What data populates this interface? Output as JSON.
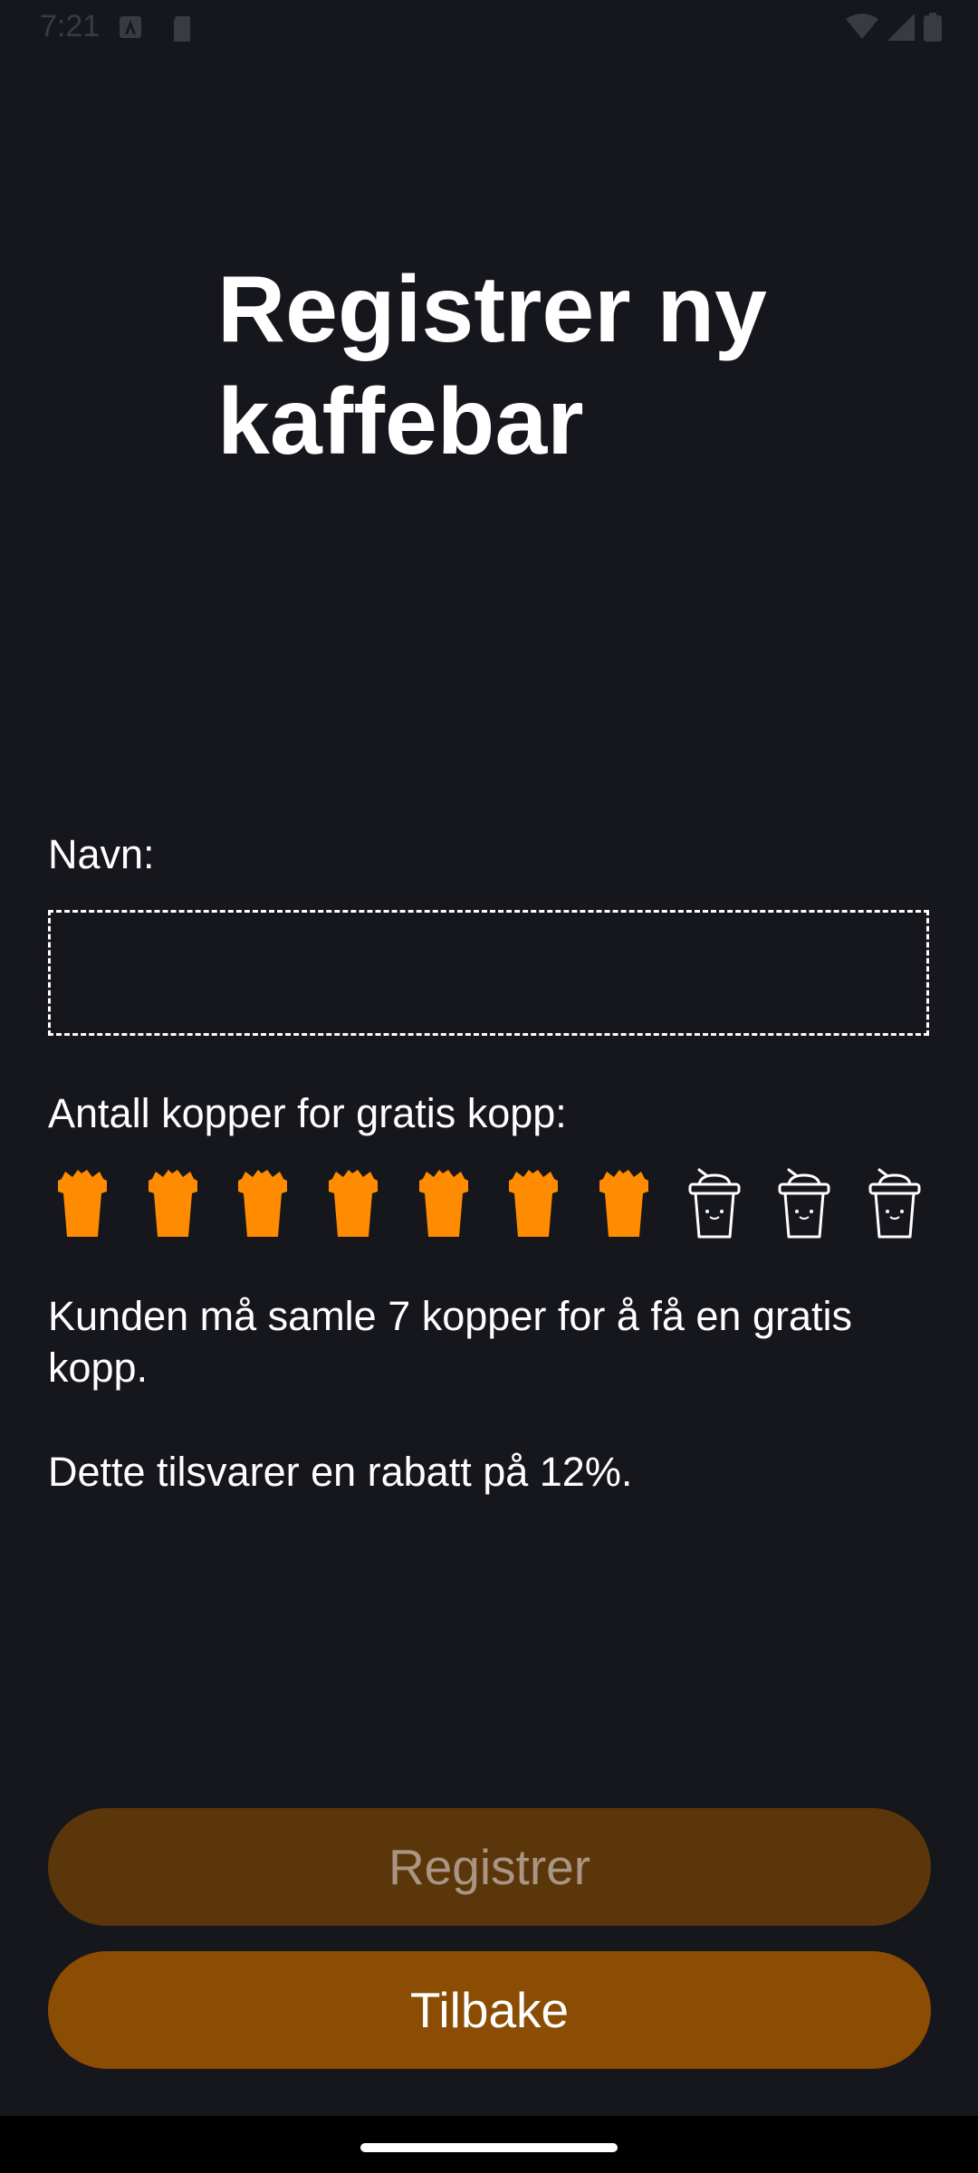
{
  "status_bar": {
    "time": "7:21",
    "icons_left": [
      "accessibility-icon",
      "sd-card-icon"
    ],
    "icons_right": [
      "wifi-icon",
      "cell-signal-icon",
      "battery-icon"
    ]
  },
  "page": {
    "title": "Registrer ny kaffebar"
  },
  "form": {
    "name_label": "Navn:",
    "name_value": "",
    "cups_label": "Antall kopper for gratis kopp:",
    "cups_total": 10,
    "cups_selected": 7,
    "info_required": "Kunden må samle 7 kopper for å få en gratis kopp.",
    "info_discount": "Dette tilsvarer en rabatt på 12%."
  },
  "buttons": {
    "register_label": "Registrer",
    "back_label": "Tilbake"
  },
  "colors": {
    "background": "#16161d",
    "accent_orange": "#ff8c00",
    "register_button": "#5b360b",
    "back_button": "#8b4d03"
  }
}
